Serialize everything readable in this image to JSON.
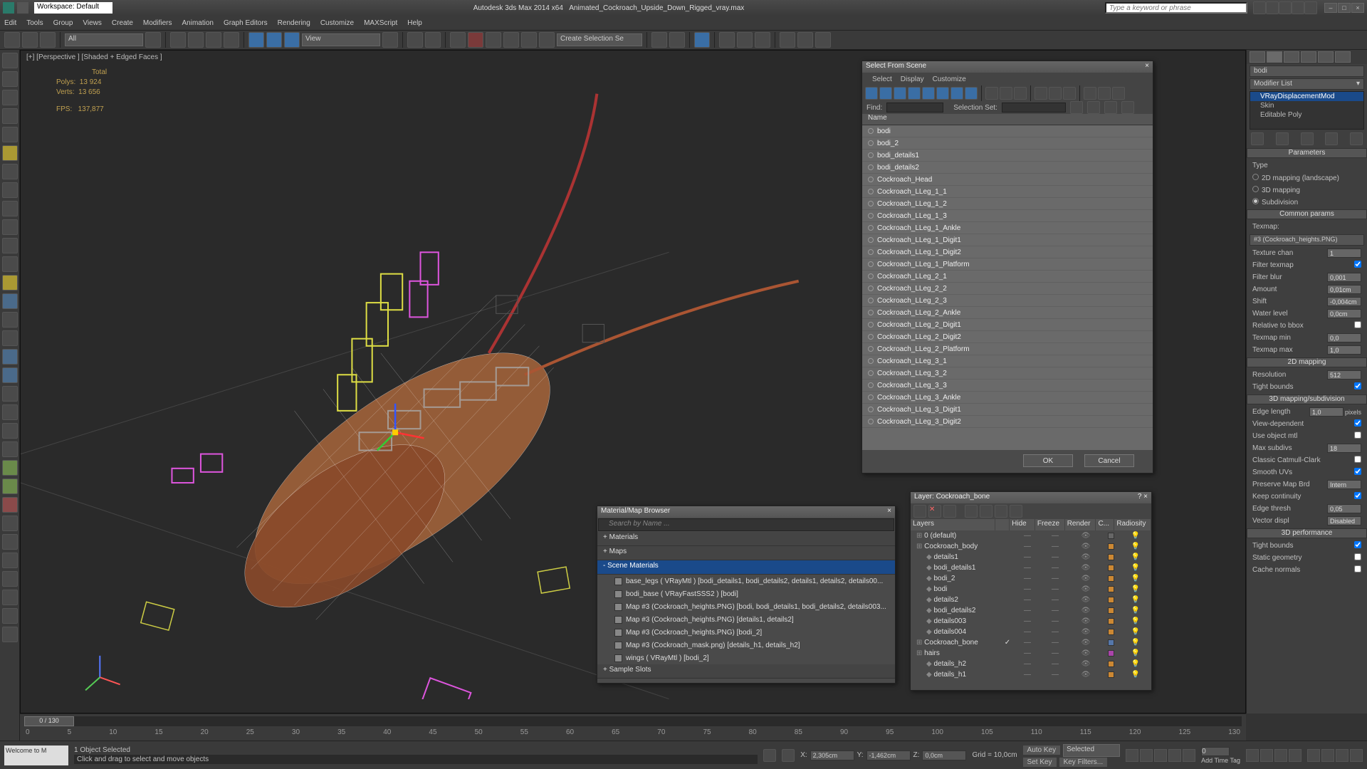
{
  "title": {
    "app": "Autodesk 3ds Max  2014 x64",
    "file": "Animated_Cockroach_Upside_Down_Rigged_vray.max",
    "workspace_label": "Workspace: Default"
  },
  "search_placeholder": "Type a keyword or phrase",
  "menu": [
    "Edit",
    "Tools",
    "Group",
    "Views",
    "Create",
    "Modifiers",
    "Animation",
    "Graph Editors",
    "Rendering",
    "Customize",
    "MAXScript",
    "Help"
  ],
  "toolbar": {
    "all": "All",
    "view": "View",
    "selset": "Create Selection Se"
  },
  "viewport": {
    "label": "[+] [Perspective ] [Shaded + Edged Faces ]",
    "stats": {
      "hdr": "Total",
      "polys_l": "Polys:",
      "polys": "13 924",
      "verts_l": "Verts:",
      "verts": "13 656",
      "fps_l": "FPS:",
      "fps": "137,877"
    }
  },
  "scene_dlg": {
    "title": "Select From Scene",
    "tabs": [
      "Select",
      "Display",
      "Customize"
    ],
    "find_l": "Find:",
    "selset_l": "Selection Set:",
    "name_hdr": "Name",
    "items": [
      "bodi",
      "bodi_2",
      "bodi_details1",
      "bodi_details2",
      "Cockroach_Head",
      "Cockroach_LLeg_1_1",
      "Cockroach_LLeg_1_2",
      "Cockroach_LLeg_1_3",
      "Cockroach_LLeg_1_Ankle",
      "Cockroach_LLeg_1_Digit1",
      "Cockroach_LLeg_1_Digit2",
      "Cockroach_LLeg_1_Platform",
      "Cockroach_LLeg_2_1",
      "Cockroach_LLeg_2_2",
      "Cockroach_LLeg_2_3",
      "Cockroach_LLeg_2_Ankle",
      "Cockroach_LLeg_2_Digit1",
      "Cockroach_LLeg_2_Digit2",
      "Cockroach_LLeg_2_Platform",
      "Cockroach_LLeg_3_1",
      "Cockroach_LLeg_3_2",
      "Cockroach_LLeg_3_3",
      "Cockroach_LLeg_3_Ankle",
      "Cockroach_LLeg_3_Digit1",
      "Cockroach_LLeg_3_Digit2"
    ],
    "ok": "OK",
    "cancel": "Cancel"
  },
  "mat_dlg": {
    "title": "Material/Map Browser",
    "search": "Search by Name ...",
    "cats": [
      "+ Materials",
      "+ Maps",
      "- Scene Materials"
    ],
    "mats": [
      "base_legs ( VRayMtl ) [bodi_details1, bodi_details2, details1, details2, details00...",
      "bodi_base   ( VRayFastSSS2 )  [bodi]",
      "Map #3 (Cockroach_heights.PNG) [bodi, bodi_details1, bodi_details2, details003...",
      "Map #3 (Cockroach_heights.PNG)  [details1, details2]",
      "Map #3 (Cockroach_heights.PNG)  [bodi_2]",
      "Map #3 (Cockroach_mask.png)  [details_h1, details_h2]",
      "wings  ( VRayMtl )  [bodi_2]"
    ],
    "bottom": "+ Sample Slots"
  },
  "layer_dlg": {
    "title": "Layer: Cockroach_bone",
    "cols": [
      "Layers",
      "",
      "Hide",
      "Freeze",
      "Render",
      "C...",
      "Radiosity"
    ],
    "rows": [
      {
        "name": "0 (default)",
        "indent": 0,
        "color": "#666"
      },
      {
        "name": "Cockroach_body",
        "indent": 0,
        "color": "#cc8833"
      },
      {
        "name": "details1",
        "indent": 1,
        "color": "#cc8833"
      },
      {
        "name": "bodi_details1",
        "indent": 1,
        "color": "#cc8833"
      },
      {
        "name": "bodi_2",
        "indent": 1,
        "color": "#cc8833"
      },
      {
        "name": "bodi",
        "indent": 1,
        "color": "#cc8833"
      },
      {
        "name": "details2",
        "indent": 1,
        "color": "#cc8833"
      },
      {
        "name": "bodi_details2",
        "indent": 1,
        "color": "#cc8833"
      },
      {
        "name": "details003",
        "indent": 1,
        "color": "#cc8833"
      },
      {
        "name": "details004",
        "indent": 1,
        "color": "#cc8833"
      },
      {
        "name": "Cockroach_bone",
        "indent": 0,
        "check": true,
        "color": "#5577aa"
      },
      {
        "name": "hairs",
        "indent": 0,
        "color": "#aa44aa"
      },
      {
        "name": "details_h2",
        "indent": 1,
        "color": "#cc8833"
      },
      {
        "name": "details_h1",
        "indent": 1,
        "color": "#cc8833"
      }
    ]
  },
  "rpanel": {
    "obj": "bodi",
    "modlist_l": "Modifier List",
    "mods": [
      "VRayDisplacementMod",
      "Skin",
      "Editable Poly"
    ],
    "params_hdr": "Parameters",
    "type_hdr": "Type",
    "type_opts": [
      "2D mapping (landscape)",
      "3D mapping",
      "Subdivision"
    ],
    "common_hdr": "Common params",
    "texmap_l": "Texmap:",
    "texmap": "#3 (Cockroach_heights.PNG)",
    "rows": [
      {
        "l": "Texture chan",
        "v": "1"
      },
      {
        "l": "Filter texmap",
        "cb": true
      },
      {
        "l": "Filter blur",
        "v": "0,001"
      },
      {
        "l": "Amount",
        "v": "0,01cm"
      },
      {
        "l": "Shift",
        "v": "-0,004cm"
      },
      {
        "l": "Water level",
        "v": "0,0cm"
      },
      {
        "l": "Relative to bbox",
        "cb": false
      },
      {
        "l": "Texmap min",
        "v": "0,0"
      },
      {
        "l": "Texmap max",
        "v": "1,0"
      }
    ],
    "map2d_hdr": "2D mapping",
    "map2d": [
      {
        "l": "Resolution",
        "v": "512"
      },
      {
        "l": "Tight bounds",
        "cb": true
      }
    ],
    "subd_hdr": "3D mapping/subdivision",
    "subd": [
      {
        "l": "Edge length",
        "v": "1,0",
        "suf": "pixels"
      },
      {
        "l": "View-dependent",
        "cb": true
      },
      {
        "l": "Use object mtl",
        "cb": false
      },
      {
        "l": "Max subdivs",
        "v": "18"
      },
      {
        "l": "Classic Catmull-Clark",
        "cb": false
      },
      {
        "l": "Smooth UVs",
        "cb": true
      },
      {
        "l": "Preserve Map Brd",
        "v": "Intern"
      },
      {
        "l": "Keep continuity",
        "cb": true
      },
      {
        "l": "Edge thresh",
        "v": "0,05"
      },
      {
        "l": "Vector displ",
        "v": "Disabled"
      }
    ],
    "perf_hdr": "3D performance",
    "perf": [
      {
        "l": "Tight bounds",
        "cb": true
      },
      {
        "l": "Static geometry",
        "cb": false
      },
      {
        "l": "Cache normals",
        "cb": false
      }
    ]
  },
  "timeline": {
    "pos": "0 / 130",
    "ticks": [
      "0",
      "5",
      "10",
      "15",
      "20",
      "25",
      "30",
      "35",
      "40",
      "45",
      "50",
      "55",
      "60",
      "65",
      "70",
      "75",
      "80",
      "85",
      "90",
      "95",
      "100",
      "105",
      "110",
      "115",
      "120",
      "125",
      "130"
    ]
  },
  "status": {
    "welcome": "Welcome to M",
    "sel": "1 Object Selected",
    "hint": "Click and drag to select and move objects",
    "x_l": "X:",
    "x": "2,305cm",
    "y_l": "Y:",
    "y": "-1,462cm",
    "z_l": "Z:",
    "z": "0,0cm",
    "grid": "Grid = 10,0cm",
    "autokey": "Auto Key",
    "setkey": "Set Key",
    "selected": "Selected",
    "keyf": "Key Filters...",
    "addtag": "Add Time Tag"
  }
}
